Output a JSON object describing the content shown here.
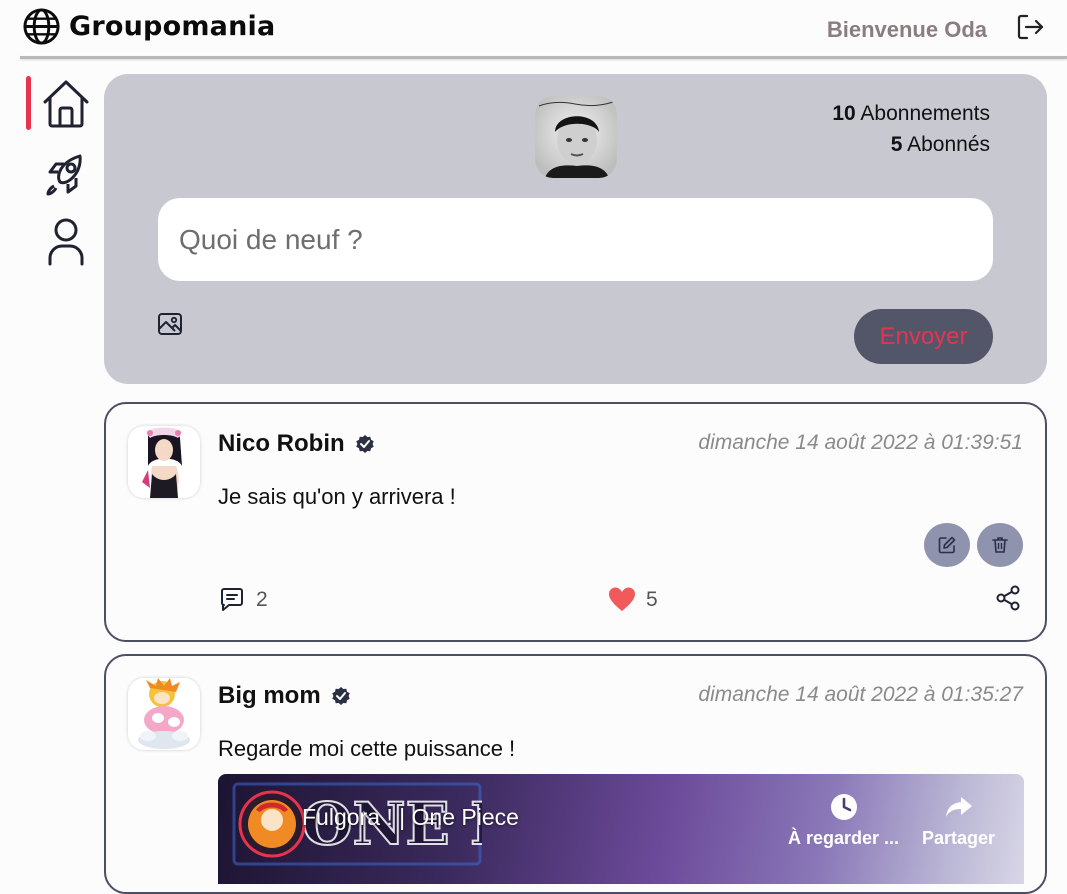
{
  "header": {
    "brand": "Groupomania",
    "welcome": "Bienvenue Oda",
    "logout_icon": "logout-icon"
  },
  "nav": {
    "items": [
      {
        "name": "home",
        "icon": "home-icon",
        "active": true
      },
      {
        "name": "explore",
        "icon": "rocket-icon",
        "active": false
      },
      {
        "name": "profile",
        "icon": "user-icon",
        "active": false
      }
    ]
  },
  "composer": {
    "following_count": "10",
    "following_label": "Abonnements",
    "followers_count": "5",
    "followers_label": "Abonnés",
    "placeholder": "Quoi de neuf ?",
    "send_label": "Envoyer",
    "image_icon": "image-icon"
  },
  "posts": [
    {
      "author": "Nico Robin",
      "date": "dimanche 14 août 2022 à 01:39:51",
      "text": "Je sais qu'on y arrivera !",
      "comments": "2",
      "likes": "5"
    },
    {
      "author": "Big mom",
      "date": "dimanche 14 août 2022 à 01:35:27",
      "text": "Regarde moi cette puissance !",
      "video": {
        "title": "Fulgora ! | One Piece",
        "watch_later": "À regarder ...",
        "share": "Partager"
      }
    }
  ],
  "colors": {
    "accent": "#e8334f",
    "composer_bg": "#c8c8d1",
    "send_bg": "#535669",
    "action_bg": "#8f93ad",
    "like": "#f05a5a"
  }
}
